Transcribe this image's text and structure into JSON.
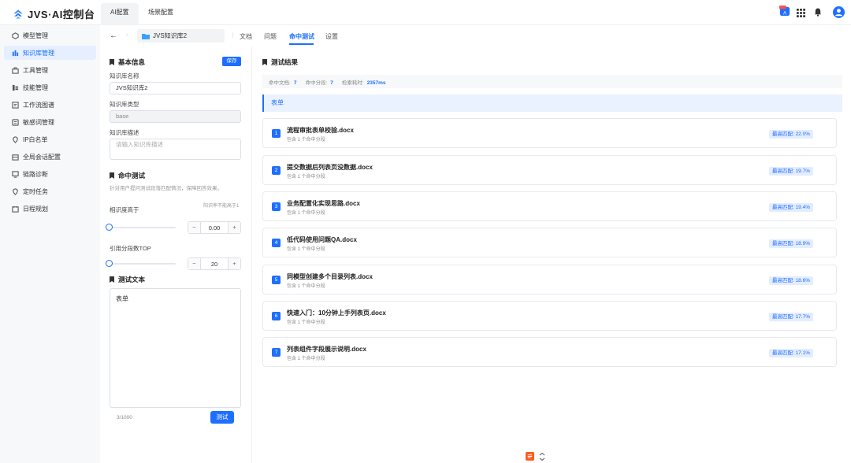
{
  "app": {
    "title": "JVS·AI控制台",
    "tabs": [
      {
        "label": "AI配置",
        "active": true
      },
      {
        "label": "场景配置",
        "active": false
      }
    ],
    "user_badge_letter": "A"
  },
  "sidebar": {
    "items": [
      {
        "label": "模型管理",
        "icon": "model-icon",
        "active": false
      },
      {
        "label": "知识库管理",
        "icon": "knowledge-icon",
        "active": true
      },
      {
        "label": "工具管理",
        "icon": "tool-icon",
        "active": false
      },
      {
        "label": "技能管理",
        "icon": "skill-icon",
        "active": false
      },
      {
        "label": "工作流图谱",
        "icon": "workflow-icon",
        "active": false
      },
      {
        "label": "敏感词管理",
        "icon": "sensitive-icon",
        "active": false
      },
      {
        "label": "IP白名单",
        "icon": "ip-icon",
        "active": false
      },
      {
        "label": "全局会话配置",
        "icon": "session-icon",
        "active": false
      },
      {
        "label": "链路诊断",
        "icon": "diagnose-icon",
        "active": false
      },
      {
        "label": "定时任务",
        "icon": "clock-icon",
        "active": false
      },
      {
        "label": "日程规划",
        "icon": "calendar-icon",
        "active": false
      }
    ]
  },
  "header": {
    "kb_name": "JVS知识库2",
    "tabs": [
      {
        "label": "文档",
        "active": false
      },
      {
        "label": "问题",
        "active": false
      },
      {
        "label": "命中测试",
        "active": true
      },
      {
        "label": "设置",
        "active": false
      }
    ]
  },
  "form": {
    "basic_title": "基本信息",
    "save_label": "保存",
    "name_label": "知识库名称",
    "name_value": "JVS知识库2",
    "type_label": "知识库类型",
    "type_value": "base",
    "desc_label": "知识库描述",
    "desc_placeholder": "请输入知识库描述",
    "hit_title": "命中测试",
    "hit_desc": "针对用户提问测试段落匹配情况，保障回答效果。",
    "similarity_label": "相识度高于",
    "similarity_hint": "阳识率不能高于1",
    "similarity_value": "0.00",
    "similarity_level": 0,
    "top_label": "引用分段数TOP",
    "top_value": "20",
    "top_level": 0,
    "text_title": "测试文本",
    "text_value": "表单",
    "count": "3/1000",
    "test_label": "测试"
  },
  "results": {
    "title": "测试结果",
    "stats": {
      "docs_label": "命中文档:",
      "docs_value": "7",
      "segs_label": "命中分段:",
      "segs_value": "7",
      "time_label": "检索耗时:",
      "time_value": "2357ms"
    },
    "query": "表单",
    "items": [
      {
        "num": "1",
        "name": "流程审批表单校验.docx",
        "sub": "包含 1 个命中分段",
        "score": "最高匹配: 22.0%"
      },
      {
        "num": "2",
        "name": "提交数据后列表页没数据.docx",
        "sub": "包含 1 个命中分段",
        "score": "最高匹配: 19.7%"
      },
      {
        "num": "3",
        "name": "业务配置化实现思路.docx",
        "sub": "包含 1 个命中分段",
        "score": "最高匹配: 19.4%"
      },
      {
        "num": "4",
        "name": "低代码使用问题QA.docx",
        "sub": "包含 1 个命中分段",
        "score": "最高匹配: 18.9%"
      },
      {
        "num": "5",
        "name": "同模型创建多个目录列表.docx",
        "sub": "包含 1 个命中分段",
        "score": "最高匹配: 18.6%"
      },
      {
        "num": "6",
        "name": "快速入门：10分钟上手列表页.docx",
        "sub": "包含 1 个命中分段",
        "score": "最高匹配: 17.7%"
      },
      {
        "num": "7",
        "name": "列表组件字段展示说明.docx",
        "sub": "包含 1 个命中分段",
        "score": "最高匹配: 17.1%"
      }
    ]
  },
  "colors": {
    "accent": "#1e6fff",
    "sidebar_bg": "#f7f8fa"
  }
}
